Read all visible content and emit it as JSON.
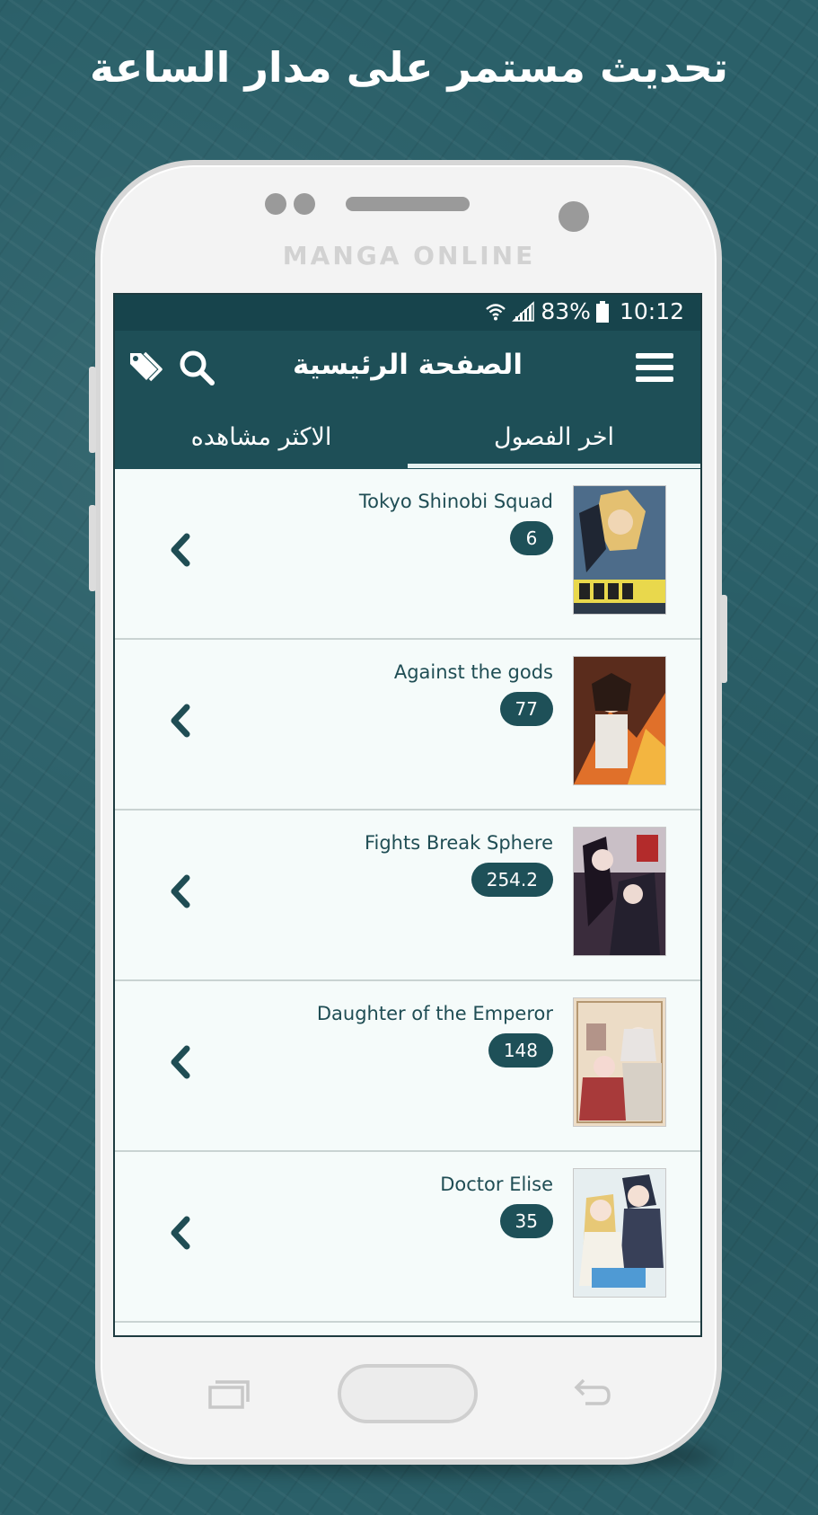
{
  "headline": "تحديث مستمر على مدار الساعة",
  "brand": "MANGA ONLINE",
  "status_bar": {
    "battery": "83%",
    "time": "10:12"
  },
  "app_bar": {
    "title": "الصفحة الرئيسية",
    "menu_icon": "hamburger-icon",
    "search_icon": "search-icon",
    "tags_icon": "tags-icon"
  },
  "tabs": [
    {
      "label": "اخر الفصول",
      "active": true
    },
    {
      "label": "الاكثر مشاهده",
      "active": false
    }
  ],
  "items": [
    {
      "title": "Tokyo Shinobi Squad",
      "chapter": "6"
    },
    {
      "title": "Against the gods",
      "chapter": "77"
    },
    {
      "title": "Fights Break Sphere",
      "chapter": "254.2"
    },
    {
      "title": "Daughter of the Emperor",
      "chapter": "148"
    },
    {
      "title": "Doctor Elise",
      "chapter": "35"
    }
  ],
  "colors": {
    "primary": "#1e4f57",
    "status": "#17444c",
    "badge": "#1e5058",
    "list_bg": "#f5fbfa",
    "background": "#2b6069"
  }
}
